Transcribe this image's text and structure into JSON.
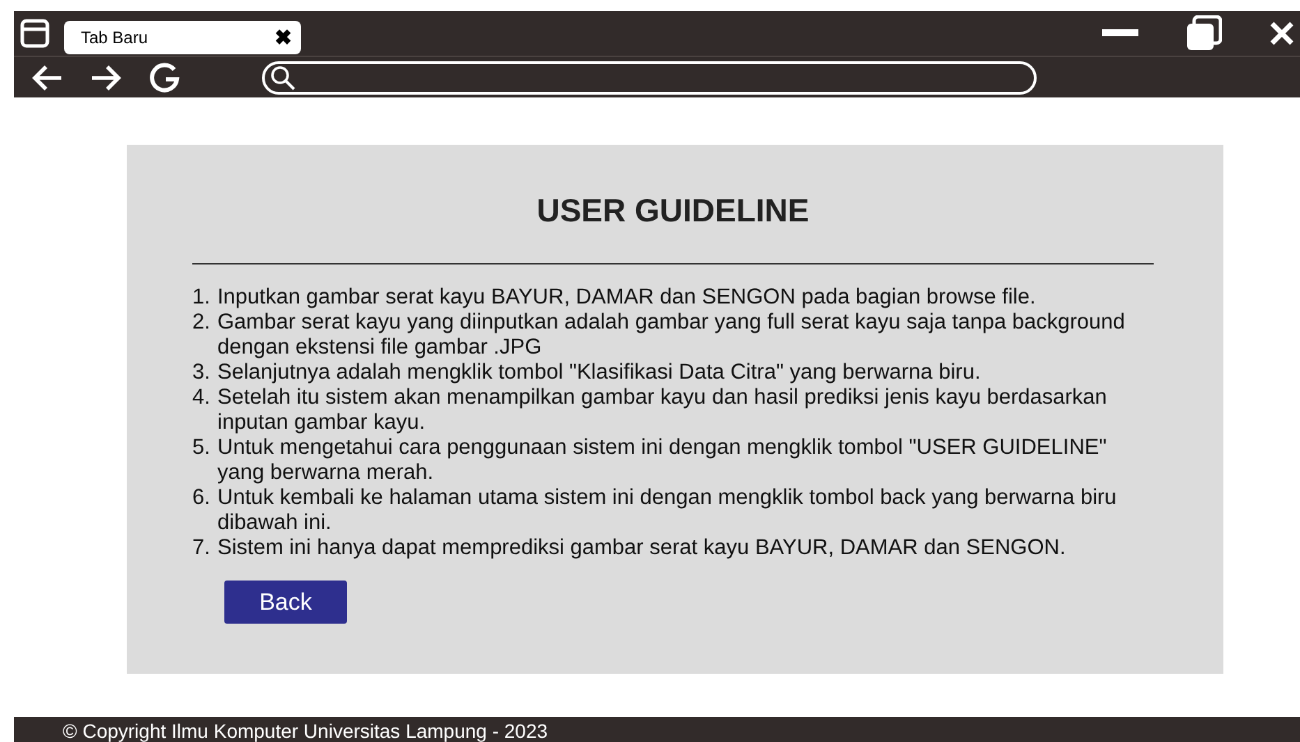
{
  "browser": {
    "tab": {
      "label": "Tab Baru",
      "close": "✖"
    }
  },
  "guideline": {
    "title": "USER GUIDELINE",
    "items": [
      {
        "number": "1.",
        "text": "Inputkan gambar serat kayu BAYUR, DAMAR dan SENGON pada bagian browse file."
      },
      {
        "number": "2.",
        "text": "Gambar serat kayu yang diinputkan adalah gambar yang full serat kayu saja tanpa background dengan ekstensi file gambar .JPG"
      },
      {
        "number": "3.",
        "text": "Selanjutnya adalah mengklik tombol \"Klasifikasi Data Citra\" yang berwarna biru."
      },
      {
        "number": "4.",
        "text": "Setelah itu sistem akan menampilkan gambar kayu dan hasil prediksi jenis kayu berdasarkan inputan gambar kayu."
      },
      {
        "number": "5.",
        "text": "Untuk mengetahui cara penggunaan sistem ini dengan mengklik tombol \"USER GUIDELINE\" yang berwarna merah."
      },
      {
        "number": "6.",
        "text": "Untuk kembali ke halaman utama sistem ini dengan mengklik tombol back yang berwarna biru dibawah ini."
      },
      {
        "number": "7.",
        "text": "Sistem ini hanya dapat memprediksi gambar serat kayu BAYUR, DAMAR dan SENGON."
      }
    ],
    "button": "Back"
  },
  "footer": "© Copyright Ilmu Komputer Universitas Lampung - 2023"
}
